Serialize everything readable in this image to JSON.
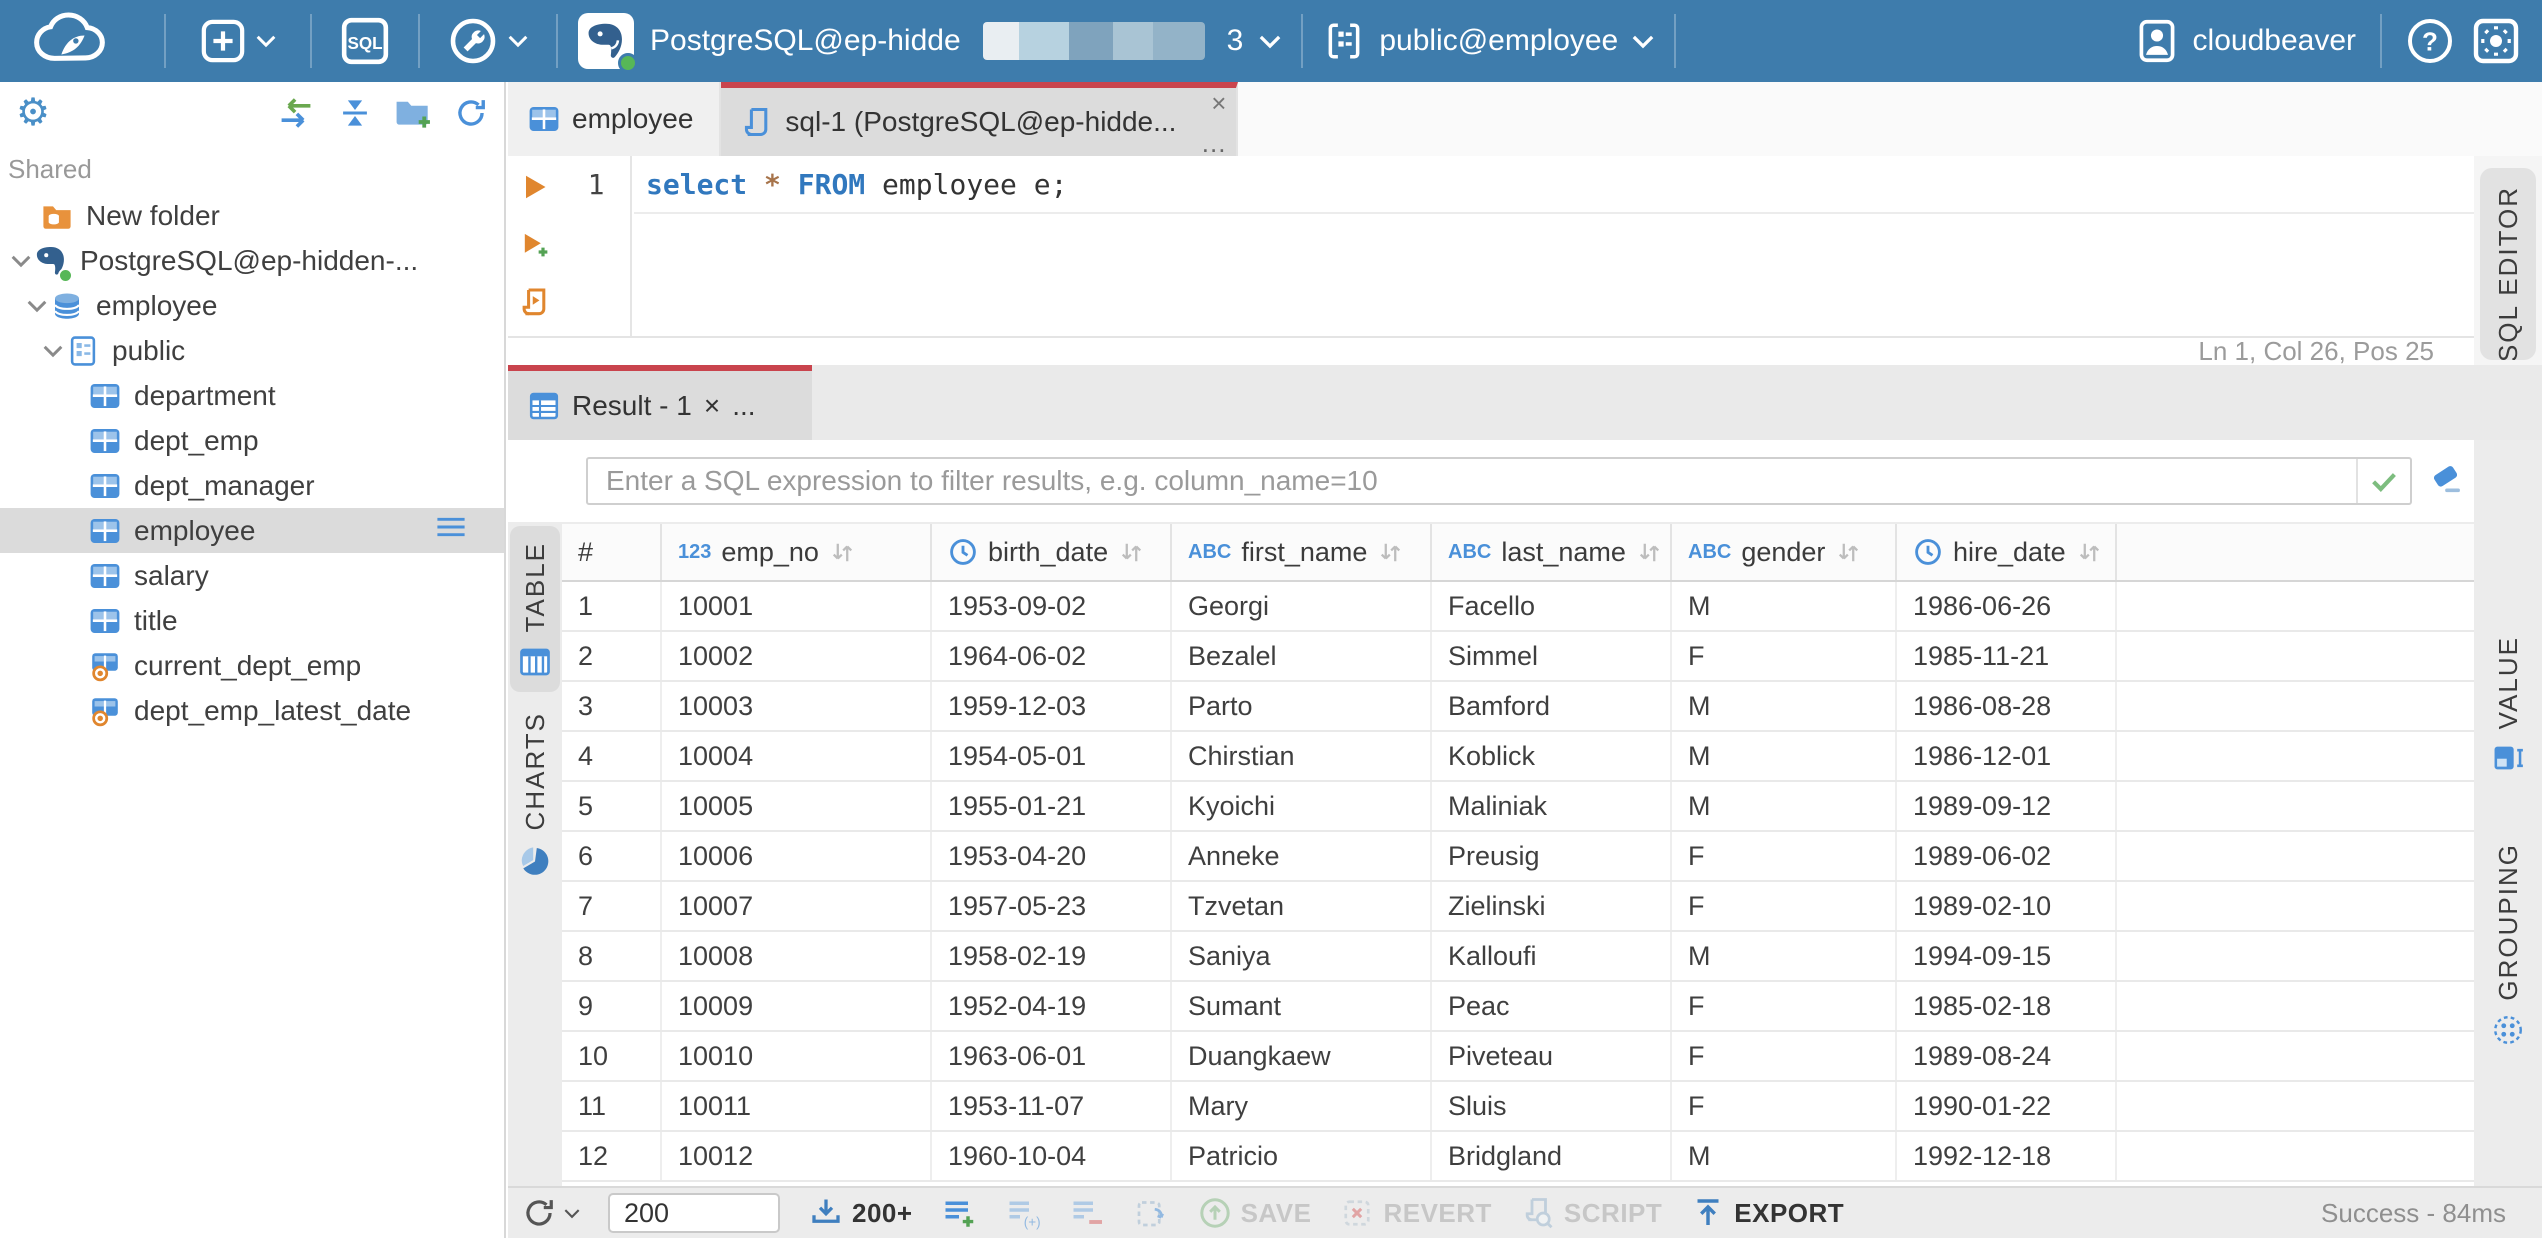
{
  "icons": {
    "gear_glyph": "⚙",
    "help_glyph": "?",
    "close_glyph": "×",
    "menu_dots_glyph": "...",
    "question_glyph": "?"
  },
  "topbar": {
    "sql_button_label": "SQL",
    "connection": {
      "visible_name": "PostgreSQL@ep-hidde",
      "masked": true,
      "suffix": "3"
    },
    "schema": "public@employee",
    "user_name": "cloudbeaver"
  },
  "sidebar": {
    "section_label": "Shared",
    "tree": [
      {
        "label": "New folder",
        "icon": "folder-database"
      },
      {
        "label": "PostgreSQL@ep-hidden-...",
        "icon": "postgresql",
        "expanded": true
      },
      {
        "label": "employee",
        "icon": "database",
        "expanded": true
      },
      {
        "label": "public",
        "icon": "schema",
        "expanded": true
      },
      {
        "label": "department",
        "icon": "table"
      },
      {
        "label": "dept_emp",
        "icon": "table"
      },
      {
        "label": "dept_manager",
        "icon": "table"
      },
      {
        "label": "employee",
        "icon": "table",
        "selected": true
      },
      {
        "label": "salary",
        "icon": "table"
      },
      {
        "label": "title",
        "icon": "table"
      },
      {
        "label": "current_dept_emp",
        "icon": "view"
      },
      {
        "label": "dept_emp_latest_date",
        "icon": "view"
      }
    ]
  },
  "tabs": {
    "employee_tab": "employee",
    "sql_tab": "sql-1 (PostgreSQL@ep-hidde..."
  },
  "sql_editor": {
    "line_number": "1",
    "tokens": [
      {
        "text": "select ",
        "type": "keyword"
      },
      {
        "text": "* ",
        "type": "operator"
      },
      {
        "text": "FROM ",
        "type": "keyword"
      },
      {
        "text": "employee e;",
        "type": "plain"
      }
    ],
    "status": "Ln 1, Col 26, Pos 25",
    "side_tab": "SQL EDITOR"
  },
  "result": {
    "tab_label": "Result - 1",
    "filter_placeholder": "Enter a SQL expression to filter results, e.g. column_name=10",
    "left_tabs": {
      "table": "TABLE",
      "charts": "CHARTS"
    },
    "right_tabs": {
      "value": "VALUE",
      "grouping": "GROUPING"
    },
    "grid": {
      "columns": [
        {
          "name": "#",
          "type": "row-number",
          "badge": ""
        },
        {
          "name": "emp_no",
          "type": "number",
          "badge": "123"
        },
        {
          "name": "birth_date",
          "type": "date",
          "badge": ""
        },
        {
          "name": "first_name",
          "type": "text",
          "badge": "ABC"
        },
        {
          "name": "last_name",
          "type": "text",
          "badge": "ABC"
        },
        {
          "name": "gender",
          "type": "text",
          "badge": "ABC"
        },
        {
          "name": "hire_date",
          "type": "date",
          "badge": ""
        }
      ],
      "rows": [
        [
          "1",
          "10001",
          "1953-09-02",
          "Georgi",
          "Facello",
          "M",
          "1986-06-26"
        ],
        [
          "2",
          "10002",
          "1964-06-02",
          "Bezalel",
          "Simmel",
          "F",
          "1985-11-21"
        ],
        [
          "3",
          "10003",
          "1959-12-03",
          "Parto",
          "Bamford",
          "M",
          "1986-08-28"
        ],
        [
          "4",
          "10004",
          "1954-05-01",
          "Chirstian",
          "Koblick",
          "M",
          "1986-12-01"
        ],
        [
          "5",
          "10005",
          "1955-01-21",
          "Kyoichi",
          "Maliniak",
          "M",
          "1989-09-12"
        ],
        [
          "6",
          "10006",
          "1953-04-20",
          "Anneke",
          "Preusig",
          "F",
          "1989-06-02"
        ],
        [
          "7",
          "10007",
          "1957-05-23",
          "Tzvetan",
          "Zielinski",
          "F",
          "1989-02-10"
        ],
        [
          "8",
          "10008",
          "1958-02-19",
          "Saniya",
          "Kalloufi",
          "M",
          "1994-09-15"
        ],
        [
          "9",
          "10009",
          "1952-04-19",
          "Sumant",
          "Peac",
          "F",
          "1985-02-18"
        ],
        [
          "10",
          "10010",
          "1963-06-01",
          "Duangkaew",
          "Piveteau",
          "F",
          "1989-08-24"
        ],
        [
          "11",
          "10011",
          "1953-11-07",
          "Mary",
          "Sluis",
          "F",
          "1990-01-22"
        ],
        [
          "12",
          "10012",
          "1960-10-04",
          "Patricio",
          "Bridgland",
          "M",
          "1992-12-18"
        ]
      ]
    },
    "toolbar": {
      "row_limit": "200",
      "fetch_label": "200+",
      "save_label": "SAVE",
      "revert_label": "REVERT",
      "script_label": "SCRIPT",
      "export_label": "EXPORT",
      "status": "Success - 84ms"
    }
  }
}
